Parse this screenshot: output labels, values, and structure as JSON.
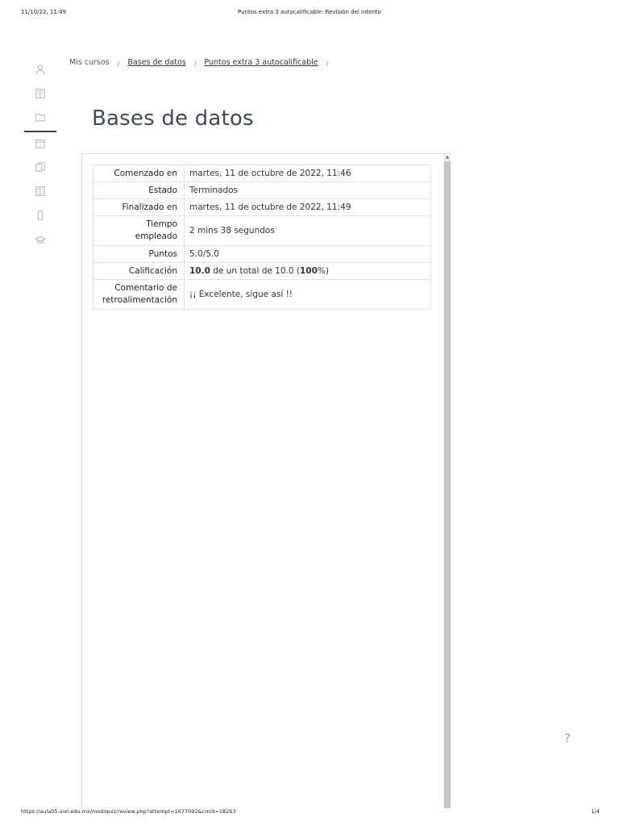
{
  "print_header": {
    "datetime": "11/10/22, 11:49",
    "title": "Puntos extra 3 autocalificable: Revisión del intento"
  },
  "print_footer": {
    "url": "https://aula05.uiel.edu.mx/mod/quiz/review.php?attempt=1677092&cmid=18263",
    "page": "1/4"
  },
  "sidebar": {
    "items": [
      {
        "icon": "user-icon"
      },
      {
        "icon": "book-icon"
      },
      {
        "icon": "folder-icon"
      },
      {
        "icon": "calendar-icon"
      },
      {
        "icon": "files-icon"
      },
      {
        "icon": "book-open-icon"
      },
      {
        "icon": "mobile-icon"
      },
      {
        "icon": "graduation-cap-icon"
      }
    ]
  },
  "breadcrumb": {
    "home": "Mis cursos",
    "course": "Bases de datos",
    "quiz": "Puntos extra 3 autocalificable",
    "sep": "/"
  },
  "page_title": "Bases de datos",
  "summary": {
    "started_label": "Comenzado en",
    "started_value": "martes, 11 de octubre de 2022, 11:46",
    "state_label": "Estado",
    "state_value": "Terminados",
    "finished_label": "Finalizado en",
    "finished_value": "martes, 11 de octubre de 2022, 11:49",
    "time_label_1": "Tiempo",
    "time_label_2": "empleado",
    "time_value": "2 mins 38 segundos",
    "points_label": "Puntos",
    "points_value": "5.0/5.0",
    "grade_label": "Calificación",
    "grade_score": "10.0",
    "grade_mid": " de un total de 10.0 (",
    "grade_pct": "100",
    "grade_end": "%)",
    "feedback_label_1": "Comentario de",
    "feedback_label_2": "retroalimentación",
    "feedback_value": "¡¡ Excelente, sigue así !!"
  },
  "help": "?"
}
